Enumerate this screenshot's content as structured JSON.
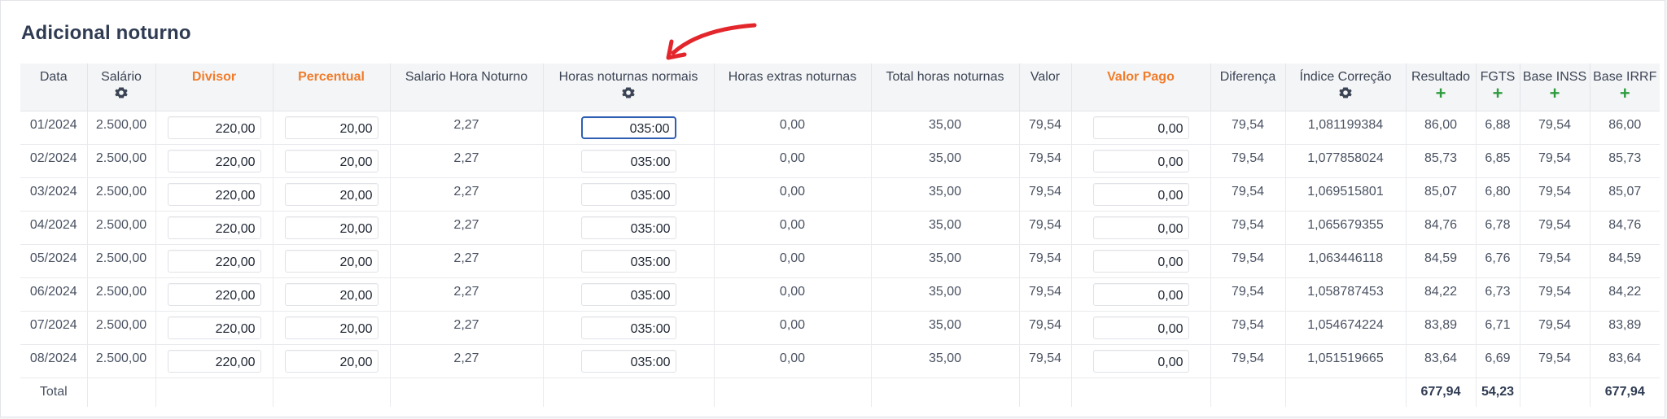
{
  "page": {
    "title": "Adicional noturno"
  },
  "table": {
    "headers": {
      "data": "Data",
      "salario": "Salário",
      "divisor": "Divisor",
      "percentual": "Percentual",
      "salario_hora_noturno": "Salario Hora Noturno",
      "horas_noturnas_normais": "Horas noturnas normais",
      "horas_extras_noturnas": "Horas extras noturnas",
      "total_horas_noturnas": "Total horas noturnas",
      "valor": "Valor",
      "valor_pago": "Valor Pago",
      "diferenca": "Diferença",
      "indice_correcao": "Índice Correção",
      "resultado": "Resultado",
      "fgts": "FGTS",
      "base_inss": "Base INSS",
      "base_irrf": "Base IRRF"
    },
    "header_icons": {
      "salario": "gear-icon",
      "horas_noturnas_normais": "gear-icon",
      "indice_correcao": "gear-icon",
      "resultado": "plus-icon",
      "fgts": "plus-icon",
      "base_inss": "plus-icon",
      "base_irrf": "plus-icon"
    },
    "rows": [
      {
        "data": "01/2024",
        "salario": "2.500,00",
        "divisor": "220,00",
        "percentual": "20,00",
        "salario_hora_noturno": "2,27",
        "horas_noturnas_normais": "035:00",
        "horas_extras_noturnas": "0,00",
        "total_horas_noturnas": "35,00",
        "valor": "79,54",
        "valor_pago": "0,00",
        "diferenca": "79,54",
        "indice_correcao": "1,081199384",
        "resultado": "86,00",
        "fgts": "6,88",
        "base_inss": "79,54",
        "base_irrf": "86,00"
      },
      {
        "data": "02/2024",
        "salario": "2.500,00",
        "divisor": "220,00",
        "percentual": "20,00",
        "salario_hora_noturno": "2,27",
        "horas_noturnas_normais": "035:00",
        "horas_extras_noturnas": "0,00",
        "total_horas_noturnas": "35,00",
        "valor": "79,54",
        "valor_pago": "0,00",
        "diferenca": "79,54",
        "indice_correcao": "1,077858024",
        "resultado": "85,73",
        "fgts": "6,85",
        "base_inss": "79,54",
        "base_irrf": "85,73"
      },
      {
        "data": "03/2024",
        "salario": "2.500,00",
        "divisor": "220,00",
        "percentual": "20,00",
        "salario_hora_noturno": "2,27",
        "horas_noturnas_normais": "035:00",
        "horas_extras_noturnas": "0,00",
        "total_horas_noturnas": "35,00",
        "valor": "79,54",
        "valor_pago": "0,00",
        "diferenca": "79,54",
        "indice_correcao": "1,069515801",
        "resultado": "85,07",
        "fgts": "6,80",
        "base_inss": "79,54",
        "base_irrf": "85,07"
      },
      {
        "data": "04/2024",
        "salario": "2.500,00",
        "divisor": "220,00",
        "percentual": "20,00",
        "salario_hora_noturno": "2,27",
        "horas_noturnas_normais": "035:00",
        "horas_extras_noturnas": "0,00",
        "total_horas_noturnas": "35,00",
        "valor": "79,54",
        "valor_pago": "0,00",
        "diferenca": "79,54",
        "indice_correcao": "1,065679355",
        "resultado": "84,76",
        "fgts": "6,78",
        "base_inss": "79,54",
        "base_irrf": "84,76"
      },
      {
        "data": "05/2024",
        "salario": "2.500,00",
        "divisor": "220,00",
        "percentual": "20,00",
        "salario_hora_noturno": "2,27",
        "horas_noturnas_normais": "035:00",
        "horas_extras_noturnas": "0,00",
        "total_horas_noturnas": "35,00",
        "valor": "79,54",
        "valor_pago": "0,00",
        "diferenca": "79,54",
        "indice_correcao": "1,063446118",
        "resultado": "84,59",
        "fgts": "6,76",
        "base_inss": "79,54",
        "base_irrf": "84,59"
      },
      {
        "data": "06/2024",
        "salario": "2.500,00",
        "divisor": "220,00",
        "percentual": "20,00",
        "salario_hora_noturno": "2,27",
        "horas_noturnas_normais": "035:00",
        "horas_extras_noturnas": "0,00",
        "total_horas_noturnas": "35,00",
        "valor": "79,54",
        "valor_pago": "0,00",
        "diferenca": "79,54",
        "indice_correcao": "1,058787453",
        "resultado": "84,22",
        "fgts": "6,73",
        "base_inss": "79,54",
        "base_irrf": "84,22"
      },
      {
        "data": "07/2024",
        "salario": "2.500,00",
        "divisor": "220,00",
        "percentual": "20,00",
        "salario_hora_noturno": "2,27",
        "horas_noturnas_normais": "035:00",
        "horas_extras_noturnas": "0,00",
        "total_horas_noturnas": "35,00",
        "valor": "79,54",
        "valor_pago": "0,00",
        "diferenca": "79,54",
        "indice_correcao": "1,054674224",
        "resultado": "83,89",
        "fgts": "6,71",
        "base_inss": "79,54",
        "base_irrf": "83,89"
      },
      {
        "data": "08/2024",
        "salario": "2.500,00",
        "divisor": "220,00",
        "percentual": "20,00",
        "salario_hora_noturno": "2,27",
        "horas_noturnas_normais": "035:00",
        "horas_extras_noturnas": "0,00",
        "total_horas_noturnas": "35,00",
        "valor": "79,54",
        "valor_pago": "0,00",
        "diferenca": "79,54",
        "indice_correcao": "1,051519665",
        "resultado": "83,64",
        "fgts": "6,69",
        "base_inss": "79,54",
        "base_irrf": "83,64"
      }
    ],
    "footer": {
      "label": "Total",
      "resultado": "677,94",
      "fgts": "54,23",
      "base_irrf": "677,94"
    }
  },
  "colors": {
    "accent_orange": "#f07c2a",
    "plus_green": "#2e9b3f",
    "focus_blue": "#2f5fb3",
    "annotation_red": "#e3262b"
  },
  "annotation": {
    "icon": "red-arrow-icon"
  }
}
